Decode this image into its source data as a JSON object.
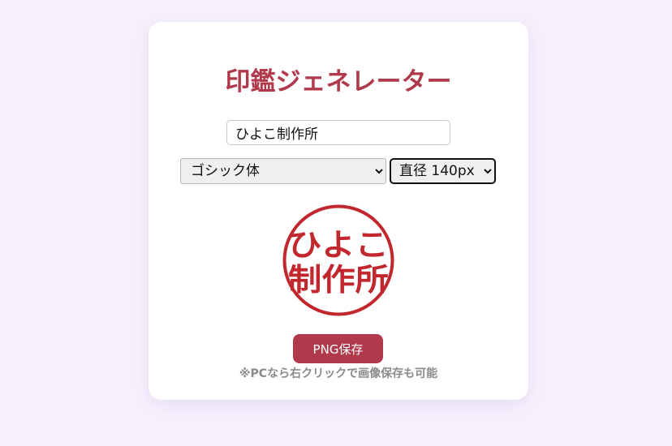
{
  "app": {
    "title": "印鑑ジェネレーター"
  },
  "name_input": {
    "value": "ひよこ制作所"
  },
  "font_select": {
    "selected": "ゴシック体"
  },
  "size_select": {
    "selected": "直径 140px"
  },
  "stamp": {
    "line1": "ひよこ",
    "line2": "制作所",
    "color": "#c1272d"
  },
  "save_button": {
    "label": "PNG保存"
  },
  "hint": {
    "text": "※PCなら右クリックで画像保存も可能"
  },
  "colors": {
    "accent": "#b03a4c",
    "background": "#f6effd",
    "card": "#ffffff"
  }
}
